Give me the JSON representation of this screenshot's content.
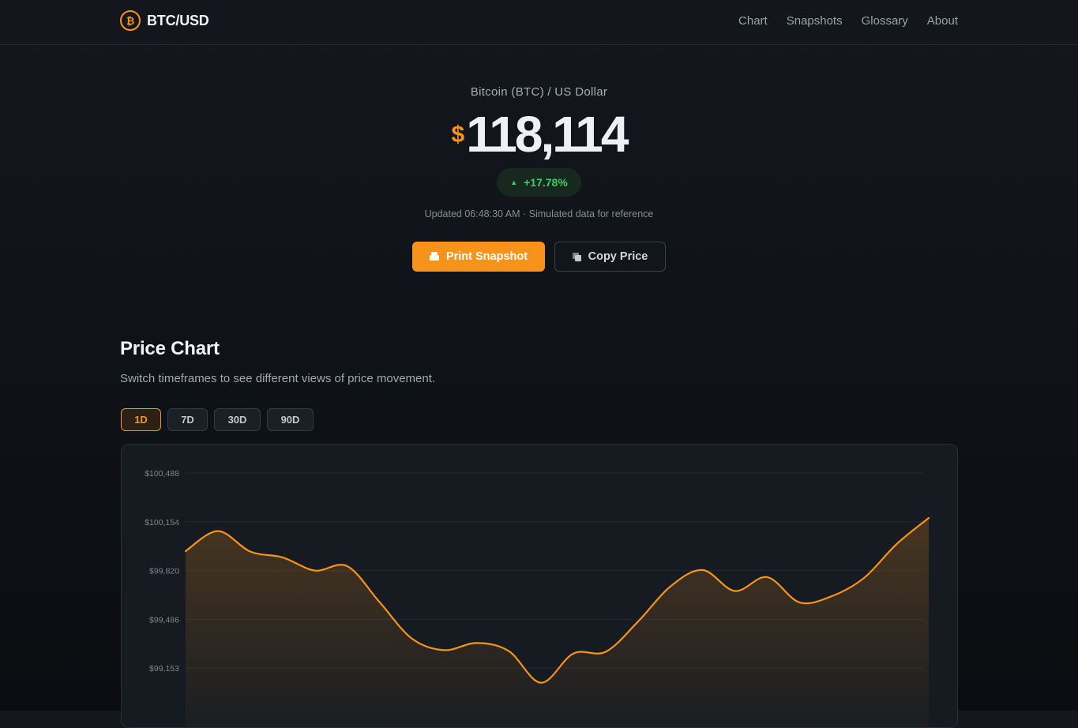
{
  "header": {
    "brand_logo_glyph": "₿",
    "brand_name": "BTC/USD",
    "nav": [
      {
        "label": "Chart"
      },
      {
        "label": "Snapshots"
      },
      {
        "label": "Glossary"
      },
      {
        "label": "About"
      }
    ]
  },
  "hero": {
    "pair_label": "Bitcoin (BTC) / US Dollar",
    "currency_symbol": "$",
    "price": "118,114",
    "change_arrow": "▲",
    "change": "+17.78%",
    "updated": "Updated 06:48:30 AM · Simulated data for reference",
    "print_button": "Print Snapshot",
    "copy_button": "Copy Price"
  },
  "chart_section": {
    "title": "Price Chart",
    "subtitle": "Switch timeframes to see different views of price movement.",
    "timeframes": [
      "1D",
      "7D",
      "30D",
      "90D"
    ],
    "active_timeframe": "1D"
  },
  "colors": {
    "accent": "#f7931a",
    "positive": "#3ecb6a",
    "background": "#0e1116",
    "card": "#161b22"
  },
  "icons": {
    "brand": "bitcoin-icon",
    "print": "printer-icon",
    "copy": "copy-icon"
  },
  "chart_data": {
    "type": "area",
    "title": "",
    "xlabel": "",
    "ylabel": "",
    "y_ticks": [
      "$100,488",
      "$100,154",
      "$99,820",
      "$99,486",
      "$99,153"
    ],
    "y_tick_values": [
      100488,
      100154,
      99820,
      99486,
      99153
    ],
    "grid": true,
    "series": [
      {
        "values": [
          99953,
          100090,
          99950,
          99910,
          99820,
          99850,
          99605,
          99355,
          99275,
          99324,
          99270,
          99052,
          99252,
          99264,
          99470,
          99710,
          99824,
          99680,
          99775,
          99602,
          99645,
          99770,
          100000,
          100180
        ]
      }
    ]
  }
}
